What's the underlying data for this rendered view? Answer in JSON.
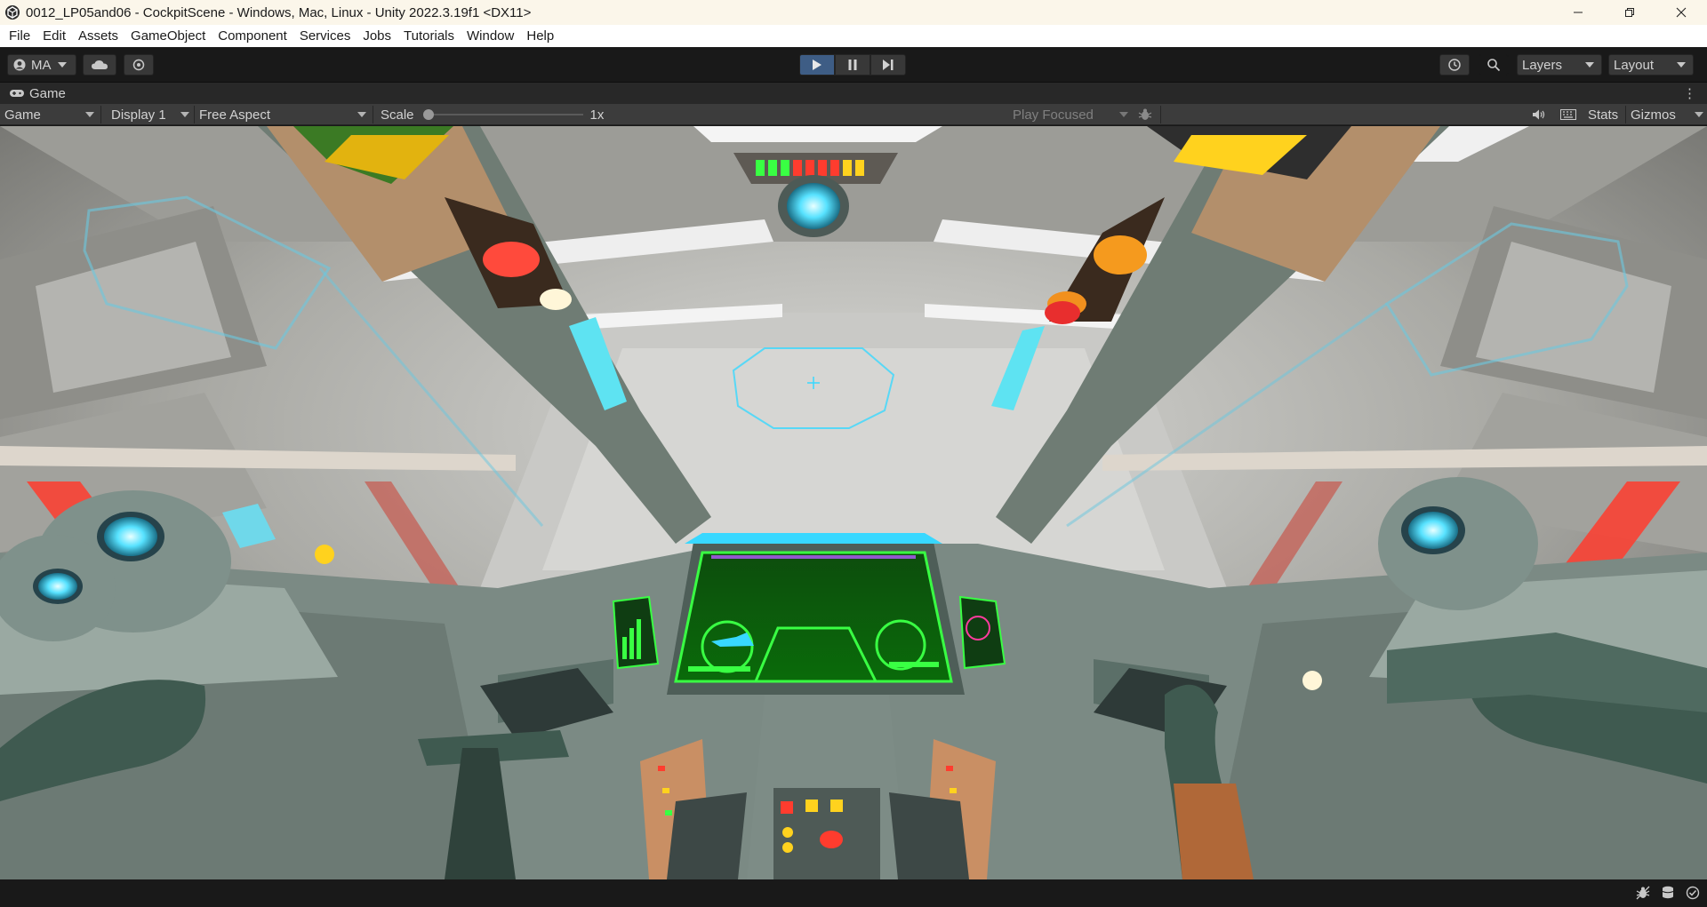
{
  "window": {
    "title": "0012_LP05and06 - CockpitScene - Windows, Mac, Linux - Unity 2022.3.19f1 <DX11>"
  },
  "menu": [
    "File",
    "Edit",
    "Assets",
    "GameObject",
    "Component",
    "Services",
    "Jobs",
    "Tutorials",
    "Window",
    "Help"
  ],
  "toolbar": {
    "account_label": "MA",
    "layers_label": "Layers",
    "layout_label": "Layout",
    "play_active": true
  },
  "tab": {
    "label": "Game"
  },
  "game_toolbar": {
    "view_mode": "Game",
    "display": "Display 1",
    "aspect": "Free Aspect",
    "scale_label": "Scale",
    "scale_value": "1x",
    "play_mode": "Play Focused",
    "stats_label": "Stats",
    "gizmos_label": "Gizmos"
  },
  "colors": {
    "play_active_bg": "#3e5d85",
    "hud_green": "#39ff43",
    "hologram_cyan": "#38d8ff",
    "warning_red": "#ff3c2e",
    "lamp_yellow": "#ffd21e"
  }
}
